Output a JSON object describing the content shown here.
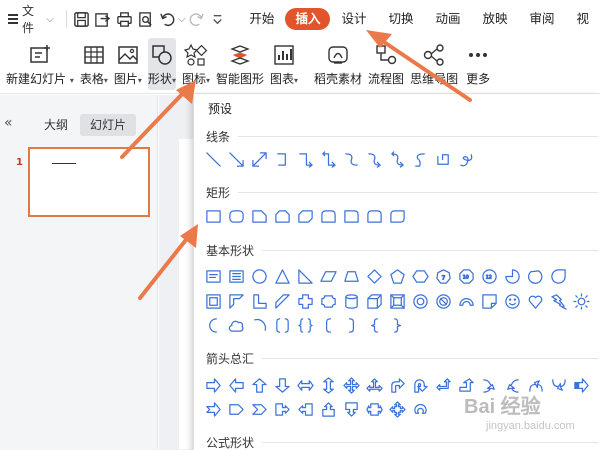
{
  "menubar": {
    "file_label": "文件",
    "tabs": [
      {
        "label": "开始",
        "active": false
      },
      {
        "label": "插入",
        "active": true
      },
      {
        "label": "设计",
        "active": false
      },
      {
        "label": "切换",
        "active": false
      },
      {
        "label": "动画",
        "active": false
      },
      {
        "label": "放映",
        "active": false
      },
      {
        "label": "审阅",
        "active": false
      },
      {
        "label": "视",
        "active": false
      }
    ],
    "active_color": "#e2542c"
  },
  "ribbon": {
    "new_slide": "新建幻灯片",
    "table": "表格",
    "picture": "图片",
    "shape": "形状",
    "icon": "图标",
    "smart_graphic": "智能图形",
    "chart": "图表",
    "stock_material": "稻壳素材",
    "flowchart": "流程图",
    "mindmap": "思维导图",
    "more": "更多"
  },
  "leftpanel": {
    "outline_tab": "大纲",
    "slides_tab": "幻灯片",
    "slide_number": "1"
  },
  "dropdown": {
    "title": "预设",
    "sections": {
      "lines": "线条",
      "rectangles": "矩形",
      "basic": "基本形状",
      "arrows": "箭头总汇",
      "formula": "公式形状"
    }
  },
  "colors": {
    "accent": "#e2542c",
    "shape_stroke": "#3b72d9",
    "annotation": "#ea7a4a"
  },
  "watermark": {
    "brand": "Bai 经验",
    "site": "jingyan.baidu.com"
  }
}
